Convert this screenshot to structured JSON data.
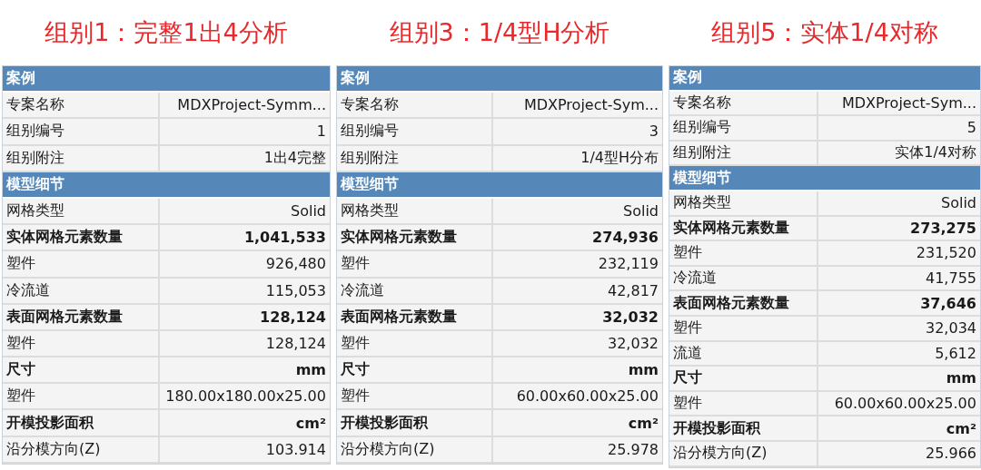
{
  "panels": [
    {
      "title": "组别1：完整1出4分析",
      "rows": [
        {
          "kind": "section",
          "label": "案例"
        },
        {
          "kind": "normal",
          "label": "专案名称",
          "value": "MDXProject-Symm..."
        },
        {
          "kind": "normal",
          "label": "组别编号",
          "value": "1"
        },
        {
          "kind": "normal",
          "label": "组别附注",
          "value": "1出4完整"
        },
        {
          "kind": "section",
          "label": "模型细节"
        },
        {
          "kind": "normal",
          "label": "网格类型",
          "value": "Solid"
        },
        {
          "kind": "bold",
          "label": "实体网格元素数量",
          "value": "1,041,533"
        },
        {
          "kind": "normal",
          "label": "塑件",
          "value": "926,480"
        },
        {
          "kind": "normal",
          "label": "冷流道",
          "value": "115,053"
        },
        {
          "kind": "bold",
          "label": "表面网格元素数量",
          "value": "128,124"
        },
        {
          "kind": "normal",
          "label": "塑件",
          "value": "128,124"
        },
        {
          "kind": "bold",
          "label": "尺寸",
          "value": "mm"
        },
        {
          "kind": "normal",
          "label": "塑件",
          "value": "180.00x180.00x25.00"
        },
        {
          "kind": "bold",
          "label": "开模投影面积",
          "value": "cm²"
        },
        {
          "kind": "normal",
          "label": "沿分模方向(Z)",
          "value": "103.914"
        }
      ]
    },
    {
      "title": "组别3：1/4型H分析",
      "rows": [
        {
          "kind": "section",
          "label": "案例"
        },
        {
          "kind": "normal",
          "label": "专案名称",
          "value": "MDXProject-Sym..."
        },
        {
          "kind": "normal",
          "label": "组别编号",
          "value": "3"
        },
        {
          "kind": "normal",
          "label": "组别附注",
          "value": "1/4型H分布"
        },
        {
          "kind": "section",
          "label": "模型细节"
        },
        {
          "kind": "normal",
          "label": "网格类型",
          "value": "Solid"
        },
        {
          "kind": "bold",
          "label": "实体网格元素数量",
          "value": "274,936"
        },
        {
          "kind": "normal",
          "label": "塑件",
          "value": "232,119"
        },
        {
          "kind": "normal",
          "label": "冷流道",
          "value": "42,817"
        },
        {
          "kind": "bold",
          "label": "表面网格元素数量",
          "value": "32,032"
        },
        {
          "kind": "normal",
          "label": "塑件",
          "value": "32,032"
        },
        {
          "kind": "bold",
          "label": "尺寸",
          "value": "mm"
        },
        {
          "kind": "normal",
          "label": "塑件",
          "value": "60.00x60.00x25.00"
        },
        {
          "kind": "bold",
          "label": "开模投影面积",
          "value": "cm²"
        },
        {
          "kind": "normal",
          "label": "沿分模方向(Z)",
          "value": "25.978"
        }
      ]
    },
    {
      "title": "组别5：实体1/4对称",
      "rows": [
        {
          "kind": "section",
          "label": "案例"
        },
        {
          "kind": "normal",
          "label": "专案名称",
          "value": "MDXProject-Sym..."
        },
        {
          "kind": "normal",
          "label": "组别编号",
          "value": "5"
        },
        {
          "kind": "normal",
          "label": "组别附注",
          "value": "实体1/4对称"
        },
        {
          "kind": "section",
          "label": "模型细节"
        },
        {
          "kind": "normal",
          "label": "网格类型",
          "value": "Solid"
        },
        {
          "kind": "bold",
          "label": "实体网格元素数量",
          "value": "273,275"
        },
        {
          "kind": "normal",
          "label": "塑件",
          "value": "231,520"
        },
        {
          "kind": "normal",
          "label": "冷流道",
          "value": "41,755"
        },
        {
          "kind": "bold",
          "label": "表面网格元素数量",
          "value": "37,646"
        },
        {
          "kind": "normal",
          "label": "塑件",
          "value": "32,034"
        },
        {
          "kind": "normal",
          "label": "流道",
          "value": "5,612"
        },
        {
          "kind": "bold",
          "label": "尺寸",
          "value": "mm"
        },
        {
          "kind": "normal",
          "label": "塑件",
          "value": "60.00x60.00x25.00"
        },
        {
          "kind": "bold",
          "label": "开模投影面积",
          "value": "cm²"
        },
        {
          "kind": "normal",
          "label": "沿分模方向(Z)",
          "value": "25.966"
        }
      ]
    }
  ]
}
